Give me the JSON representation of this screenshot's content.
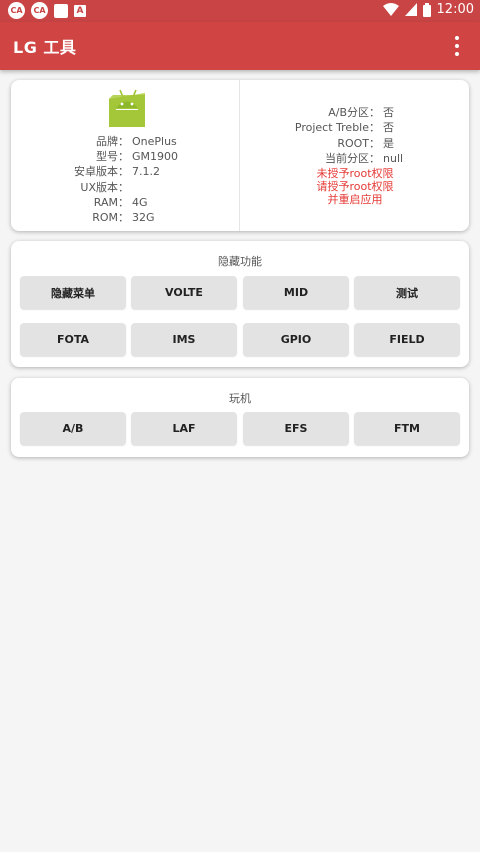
{
  "status_bar": {
    "time": "12:00",
    "left_icons": [
      "ca-icon",
      "ca-icon",
      "white-square-icon",
      "a-icon"
    ],
    "right_icons": [
      "wifi-icon",
      "signal-icon",
      "battery-icon"
    ]
  },
  "app_bar": {
    "title": "LG 工具",
    "menu_icon": "more-vert-icon",
    "color": "#d04444"
  },
  "device_info": {
    "icon": "android-icon",
    "rows": [
      {
        "label": "品牌：",
        "value": "OnePlus"
      },
      {
        "label": "型号：",
        "value": "GM1900"
      },
      {
        "label": "安卓版本：",
        "value": "7.1.2"
      },
      {
        "label": "UX版本：",
        "value": ""
      },
      {
        "label": "RAM：",
        "value": "4G"
      },
      {
        "label": "ROM：",
        "value": "32G"
      }
    ]
  },
  "system_info": {
    "rows": [
      {
        "label": "A/B分区：",
        "value": "否"
      },
      {
        "label": "Project Treble：",
        "value": "否"
      },
      {
        "label": "ROOT：",
        "value": "是"
      },
      {
        "label": "当前分区：",
        "value": "null"
      }
    ],
    "warning_lines": [
      "未授予root权限",
      "请授予root权限",
      "并重启应用"
    ],
    "warning_color": "#e53935"
  },
  "hidden_features": {
    "title": "隐藏功能",
    "buttons": [
      "隐藏菜单",
      "VOLTE",
      "MID",
      "测试",
      "FOTA",
      "IMS",
      "GPIO",
      "FIELD"
    ]
  },
  "play": {
    "title": "玩机",
    "buttons": [
      "A/B",
      "LAF",
      "EFS",
      "FTM"
    ]
  }
}
